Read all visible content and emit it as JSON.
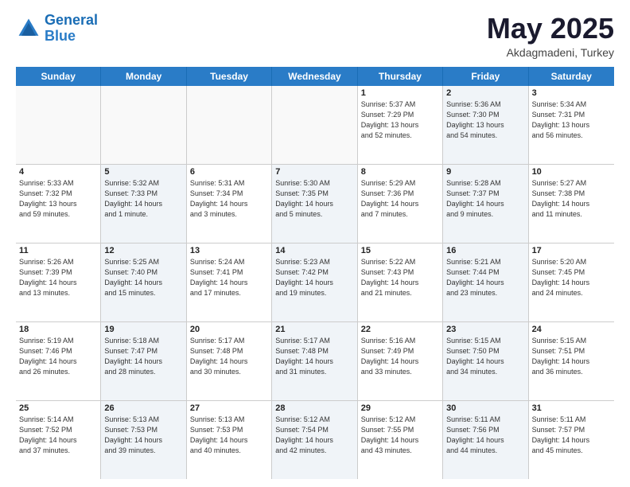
{
  "logo": {
    "line1": "General",
    "line2": "Blue"
  },
  "header": {
    "title": "May 2025",
    "subtitle": "Akdagmadeni, Turkey"
  },
  "weekdays": [
    "Sunday",
    "Monday",
    "Tuesday",
    "Wednesday",
    "Thursday",
    "Friday",
    "Saturday"
  ],
  "rows": [
    [
      {
        "day": "",
        "info": "",
        "empty": true
      },
      {
        "day": "",
        "info": "",
        "empty": true
      },
      {
        "day": "",
        "info": "",
        "empty": true
      },
      {
        "day": "",
        "info": "",
        "empty": true
      },
      {
        "day": "1",
        "info": "Sunrise: 5:37 AM\nSunset: 7:29 PM\nDaylight: 13 hours\nand 52 minutes."
      },
      {
        "day": "2",
        "info": "Sunrise: 5:36 AM\nSunset: 7:30 PM\nDaylight: 13 hours\nand 54 minutes.",
        "shaded": true
      },
      {
        "day": "3",
        "info": "Sunrise: 5:34 AM\nSunset: 7:31 PM\nDaylight: 13 hours\nand 56 minutes."
      }
    ],
    [
      {
        "day": "4",
        "info": "Sunrise: 5:33 AM\nSunset: 7:32 PM\nDaylight: 13 hours\nand 59 minutes."
      },
      {
        "day": "5",
        "info": "Sunrise: 5:32 AM\nSunset: 7:33 PM\nDaylight: 14 hours\nand 1 minute.",
        "shaded": true
      },
      {
        "day": "6",
        "info": "Sunrise: 5:31 AM\nSunset: 7:34 PM\nDaylight: 14 hours\nand 3 minutes."
      },
      {
        "day": "7",
        "info": "Sunrise: 5:30 AM\nSunset: 7:35 PM\nDaylight: 14 hours\nand 5 minutes.",
        "shaded": true
      },
      {
        "day": "8",
        "info": "Sunrise: 5:29 AM\nSunset: 7:36 PM\nDaylight: 14 hours\nand 7 minutes."
      },
      {
        "day": "9",
        "info": "Sunrise: 5:28 AM\nSunset: 7:37 PM\nDaylight: 14 hours\nand 9 minutes.",
        "shaded": true
      },
      {
        "day": "10",
        "info": "Sunrise: 5:27 AM\nSunset: 7:38 PM\nDaylight: 14 hours\nand 11 minutes."
      }
    ],
    [
      {
        "day": "11",
        "info": "Sunrise: 5:26 AM\nSunset: 7:39 PM\nDaylight: 14 hours\nand 13 minutes."
      },
      {
        "day": "12",
        "info": "Sunrise: 5:25 AM\nSunset: 7:40 PM\nDaylight: 14 hours\nand 15 minutes.",
        "shaded": true
      },
      {
        "day": "13",
        "info": "Sunrise: 5:24 AM\nSunset: 7:41 PM\nDaylight: 14 hours\nand 17 minutes."
      },
      {
        "day": "14",
        "info": "Sunrise: 5:23 AM\nSunset: 7:42 PM\nDaylight: 14 hours\nand 19 minutes.",
        "shaded": true
      },
      {
        "day": "15",
        "info": "Sunrise: 5:22 AM\nSunset: 7:43 PM\nDaylight: 14 hours\nand 21 minutes."
      },
      {
        "day": "16",
        "info": "Sunrise: 5:21 AM\nSunset: 7:44 PM\nDaylight: 14 hours\nand 23 minutes.",
        "shaded": true
      },
      {
        "day": "17",
        "info": "Sunrise: 5:20 AM\nSunset: 7:45 PM\nDaylight: 14 hours\nand 24 minutes."
      }
    ],
    [
      {
        "day": "18",
        "info": "Sunrise: 5:19 AM\nSunset: 7:46 PM\nDaylight: 14 hours\nand 26 minutes."
      },
      {
        "day": "19",
        "info": "Sunrise: 5:18 AM\nSunset: 7:47 PM\nDaylight: 14 hours\nand 28 minutes.",
        "shaded": true
      },
      {
        "day": "20",
        "info": "Sunrise: 5:17 AM\nSunset: 7:48 PM\nDaylight: 14 hours\nand 30 minutes."
      },
      {
        "day": "21",
        "info": "Sunrise: 5:17 AM\nSunset: 7:48 PM\nDaylight: 14 hours\nand 31 minutes.",
        "shaded": true
      },
      {
        "day": "22",
        "info": "Sunrise: 5:16 AM\nSunset: 7:49 PM\nDaylight: 14 hours\nand 33 minutes."
      },
      {
        "day": "23",
        "info": "Sunrise: 5:15 AM\nSunset: 7:50 PM\nDaylight: 14 hours\nand 34 minutes.",
        "shaded": true
      },
      {
        "day": "24",
        "info": "Sunrise: 5:15 AM\nSunset: 7:51 PM\nDaylight: 14 hours\nand 36 minutes."
      }
    ],
    [
      {
        "day": "25",
        "info": "Sunrise: 5:14 AM\nSunset: 7:52 PM\nDaylight: 14 hours\nand 37 minutes."
      },
      {
        "day": "26",
        "info": "Sunrise: 5:13 AM\nSunset: 7:53 PM\nDaylight: 14 hours\nand 39 minutes.",
        "shaded": true
      },
      {
        "day": "27",
        "info": "Sunrise: 5:13 AM\nSunset: 7:53 PM\nDaylight: 14 hours\nand 40 minutes."
      },
      {
        "day": "28",
        "info": "Sunrise: 5:12 AM\nSunset: 7:54 PM\nDaylight: 14 hours\nand 42 minutes.",
        "shaded": true
      },
      {
        "day": "29",
        "info": "Sunrise: 5:12 AM\nSunset: 7:55 PM\nDaylight: 14 hours\nand 43 minutes."
      },
      {
        "day": "30",
        "info": "Sunrise: 5:11 AM\nSunset: 7:56 PM\nDaylight: 14 hours\nand 44 minutes.",
        "shaded": true
      },
      {
        "day": "31",
        "info": "Sunrise: 5:11 AM\nSunset: 7:57 PM\nDaylight: 14 hours\nand 45 minutes."
      }
    ]
  ]
}
